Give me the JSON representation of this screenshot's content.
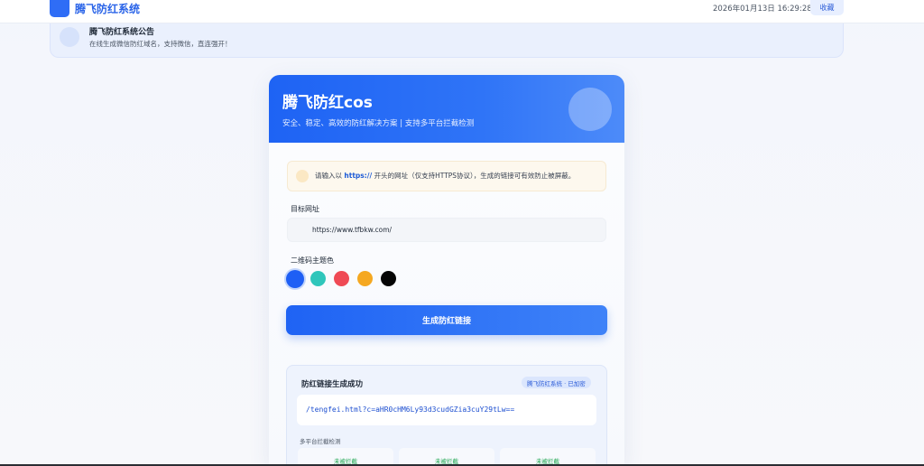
{
  "header": {
    "brand": "腾飞防红系统",
    "datetime": "2026年01月13日 16:29:28",
    "favorite_label": "收藏"
  },
  "announcement": {
    "title": "腾飞防红系统公告",
    "text": "在线生成微信防红域名，支持微信，直连强开！"
  },
  "card": {
    "title": "腾飞防红cos",
    "subtitle": "安全、稳定、高效的防红解决方案 | 支持多平台拦截检测",
    "notice_prefix": "请输入以 ",
    "notice_bold": "https://",
    "notice_suffix": " 开头的网址（仅支持HTTPS协议），生成的链接可有效防止被屏蔽。",
    "url_label": "目标网址",
    "url_value": "https://www.tfbkw.com/",
    "color_label": "二维码主题色",
    "colors": [
      "#1e5ff5",
      "#2fc6bb",
      "#ef4a55",
      "#f5a821",
      "#050505"
    ],
    "selected_color": "#1e5ff5",
    "generate_label": "生成防红链接"
  },
  "result": {
    "title": "防红链接生成成功",
    "badge": "腾飞防红系统 · 已加密",
    "link": "/tengfei.html?c=aHR0cHM6Ly93d3cudGZia3cuY29tLw==",
    "platform_title": "多平台拦截检测",
    "platforms": [
      {
        "status": "未被拦截"
      },
      {
        "status": "未被拦截"
      },
      {
        "status": "未被拦截"
      }
    ]
  }
}
